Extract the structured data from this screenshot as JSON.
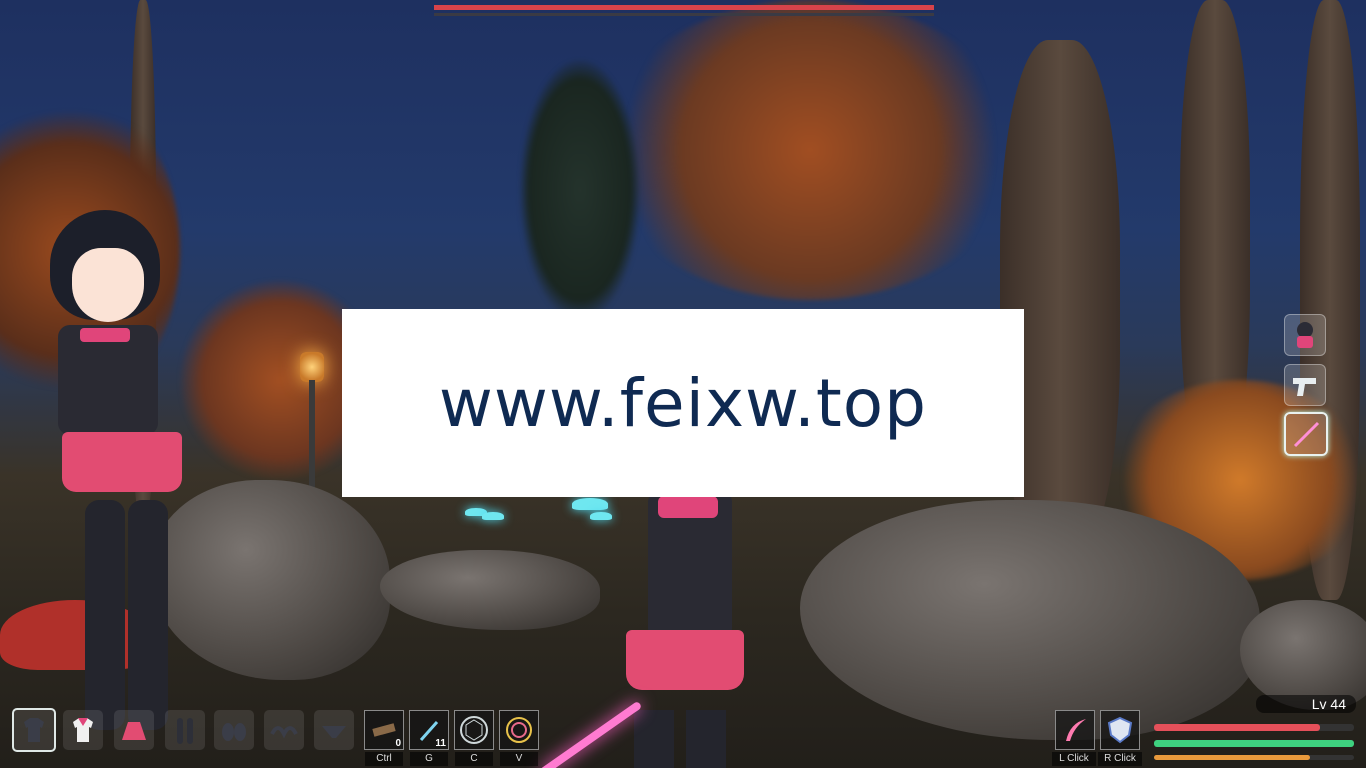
{
  "watermark": {
    "text": "www.feixw.top"
  },
  "boss_health": {
    "fraction": 1.0
  },
  "side_slots": [
    {
      "name": "character-portrait-icon",
      "active": false
    },
    {
      "name": "pistol-icon",
      "active": false
    },
    {
      "name": "sword-icon",
      "active": true
    }
  ],
  "outfit_slots": [
    {
      "name": "shirt-icon"
    },
    {
      "name": "sailor-top-icon"
    },
    {
      "name": "skirt-icon"
    },
    {
      "name": "stockings-icon"
    },
    {
      "name": "gloves-icon"
    },
    {
      "name": "bra-icon"
    },
    {
      "name": "panties-icon"
    }
  ],
  "item_slots": [
    {
      "name": "plank-icon",
      "count": "0",
      "key": "Ctrl"
    },
    {
      "name": "blade-icon",
      "count": "11",
      "key": "G"
    },
    {
      "name": "hex-shield-icon",
      "count": "",
      "key": "C"
    },
    {
      "name": "ring-icon",
      "count": "",
      "key": "V"
    }
  ],
  "skills": [
    {
      "name": "slash-skill-icon",
      "key": "L Click"
    },
    {
      "name": "shield-skill-icon",
      "key": "R Click"
    }
  ],
  "player": {
    "level": "Lv 44",
    "health_fraction": 0.83,
    "stamina_fraction": 1.0,
    "exp_fraction": 0.78
  },
  "colors": {
    "health": "#e5505a",
    "stamina": "#3ed17f",
    "exp": "#e99a3c"
  }
}
